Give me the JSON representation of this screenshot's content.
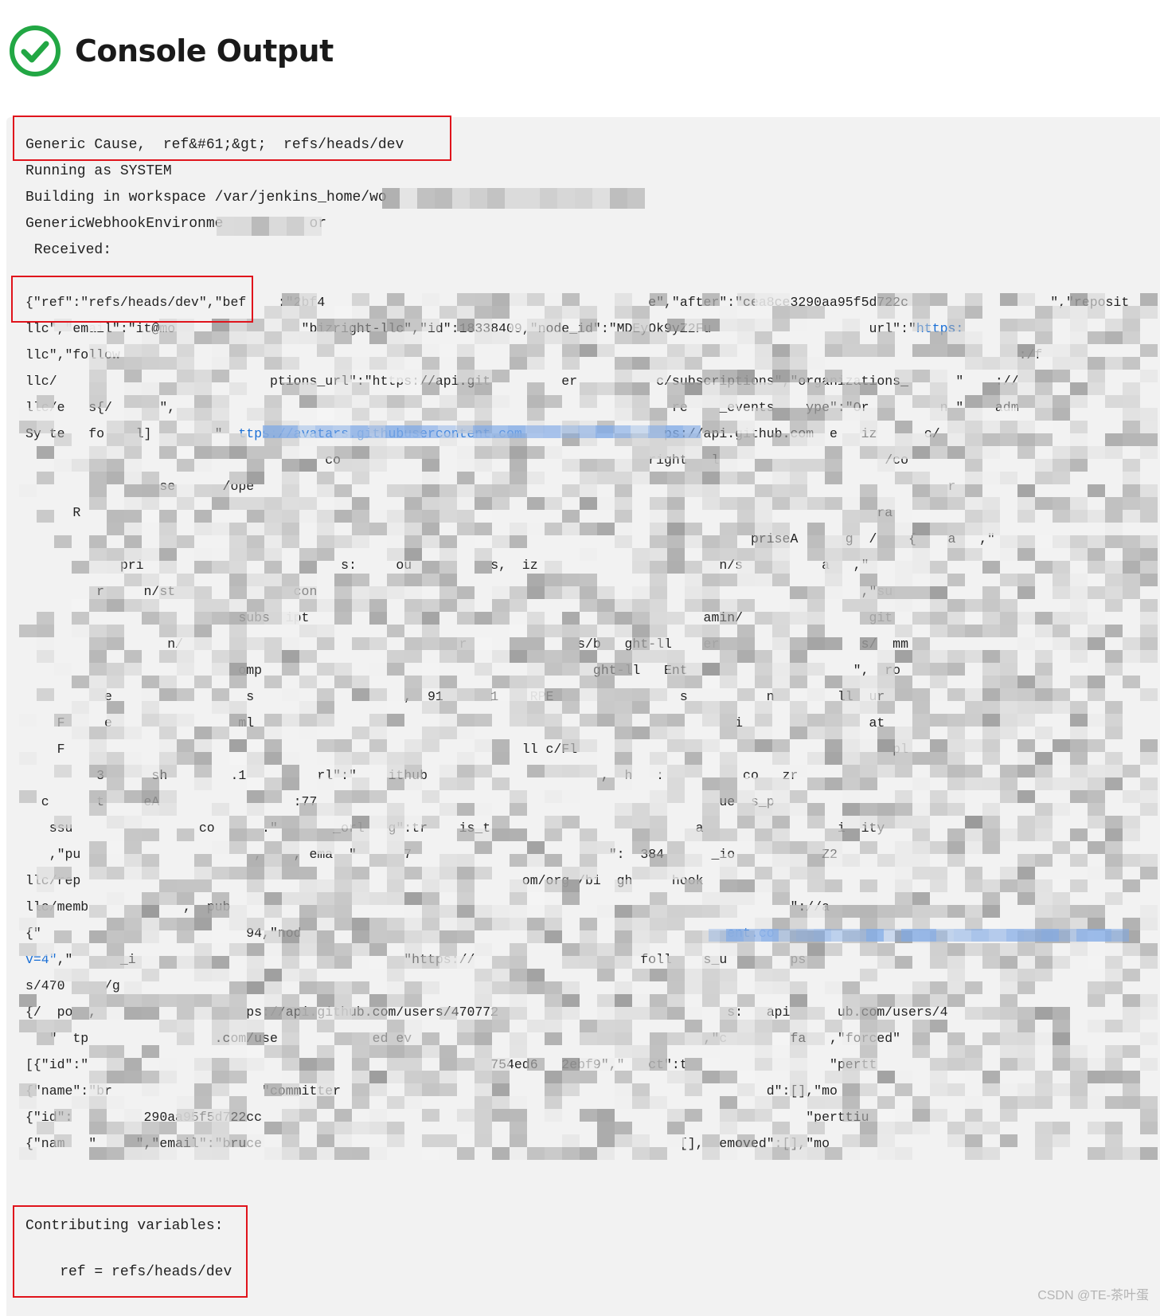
{
  "header": {
    "title": "Console Output",
    "status_icon": "check-circle-icon",
    "status_color": "#22a744"
  },
  "console": {
    "lines": [
      "Generic Cause,  ref&#61;&gt;  refs/heads/dev",
      "Running as SYSTEM",
      "Building in workspace /var/jenkins_home/wo",
      "GenericWebhookEnvironme          or",
      " Received:"
    ],
    "payload_rows": [
      [
        {
          "t": "{\"ref\":\"refs/heads/dev\",\"bef    :\"2bf4                                         e\",\"after\":\"cea8ce3290aa95f5d722c                  \",\"reposit"
        }
      ],
      [
        {
          "t": "llc\",\"email\":\"it@mo                \"bizright-llc\",\"id\":18338409,\"node_id\":\"MDEyOk9yZ2Fu                    url\":\""
        },
        {
          "t": "https:",
          "link": true
        }
      ],
      [
        {
          "t": "llc\",\"follow                                                                                                                  :/f"
        }
      ],
      [
        {
          "t": "llc/                           ptions_url\":\"https://api.git         er          c/subscriptions\",\"organizations_      \"    ://"
        }
      ],
      [
        {
          "t": "llc/e   s{/      \",                                                               re    _events    ype\":\"Or         n \"    adm"
        }
      ],
      [
        {
          "t": "Sy te   fo    l]        \""
        },
        {
          "t": "  ttps://avatars.githubusercontent.com  ",
          "link": true
        },
        {
          "t": "                ps://api.github.com  e   iz      c/"
        }
      ],
      [
        {
          "t": "                                      co                                       right   l                     /co"
        }
      ],
      [
        {
          "t": "                 se      /ope                                                                                        r"
        }
      ],
      [
        {
          "t": "      R                                                                                                     ra"
        }
      ],
      [
        {
          "t": "                                                                                            priseA      g  /    {    a   ,\""
        }
      ],
      [
        {
          "t": "            pri                         s:     ou          s,  iz                       n/s          a   ,\""
        }
      ],
      [
        {
          "t": "         r     n/st               con                                                                     ,\"su"
        }
      ],
      [
        {
          "t": "                           subs  ipt                                                  amin/                git"
        }
      ],
      [
        {
          "t": "                  n/                                   r              s/b   ght-ll    er                  s/  mm"
        }
      ],
      [
        {
          "t": "                           omp                                          ght-ll   Ent                     \",  ro"
        }
      ],
      [
        {
          "t": "          e                 s                   ,  91      1    RPE                s          n        ll  ur"
        }
      ],
      [
        {
          "t": "    F     e                ml                                                             i                at"
        }
      ],
      [
        {
          "t": "    F                                                          ll c/Fl                                        pl"
        }
      ],
      [
        {
          "t": "         3      sh        .1         rl\":\"    ithub                      ,  h   :          co   zr"
        }
      ],
      [
        {
          "t": "  c      t     eA                 :77                                                   ue  s_p"
        }
      ],
      [
        {
          "t": "   ssu                co      .\"       _orl   g\":tr    is_t                          a                 i  ity"
        }
      ],
      [
        {
          "t": "   ,\"pu                      ,    , ema  \"      7                         \":  384      _io           Z2"
        }
      ],
      [
        {
          "t": "llc/rep                                                        om/org /bi  gh     hook"
        }
      ],
      [
        {
          "t": "llc/memb            ,  pub                                                                       \"://a"
        }
      ],
      [
        {
          "t": "{\"                          94,\"nod                                                      "
        },
        {
          "t": "ent.co",
          "link": true
        }
      ],
      [
        {
          "t": "v=4\"",
          "link": true
        },
        {
          "t": ",\"      _i                                  \"https://                     foll    s_u        ps"
        }
      ],
      [
        {
          "t": "s/470     /g                                                                        "
        }
      ],
      [
        {
          "t": "{/  po  ,                   ps://api.github.com/users/470772                             s:   api      ub.com/users/4"
        }
      ],
      [
        {
          "t": "   \"  tp                .com/use            ed ev                                     ,\"c        fa   ,\"forced\""
        }
      ],
      [
        {
          "t": "[{\"id\":\"                                                   754ed6   2ebf9\",\"   ct\":t                  \"pertt"
        }
      ],
      [
        {
          "t": "{\"name\":\"br                   \"committer                                                      d\":[],\"mo"
        }
      ],
      [
        {
          "t": "{\"id\":         290aa95f5d722cc                                                                     \"perttiu"
        }
      ],
      [
        {
          "t": "{\"nam   \"     \",\"email\":\"bruce                                                     [],  emoved\":[],\"mo"
        }
      ]
    ],
    "footer_lines": [
      "Contributing variables:",
      "",
      "    ref = refs/heads/dev"
    ]
  },
  "watermark": "CSDN @TE-茶叶蛋",
  "colors": {
    "highlight_box": "#e0141c",
    "link": "#1a6fd6",
    "panel": "#f2f2f2"
  }
}
